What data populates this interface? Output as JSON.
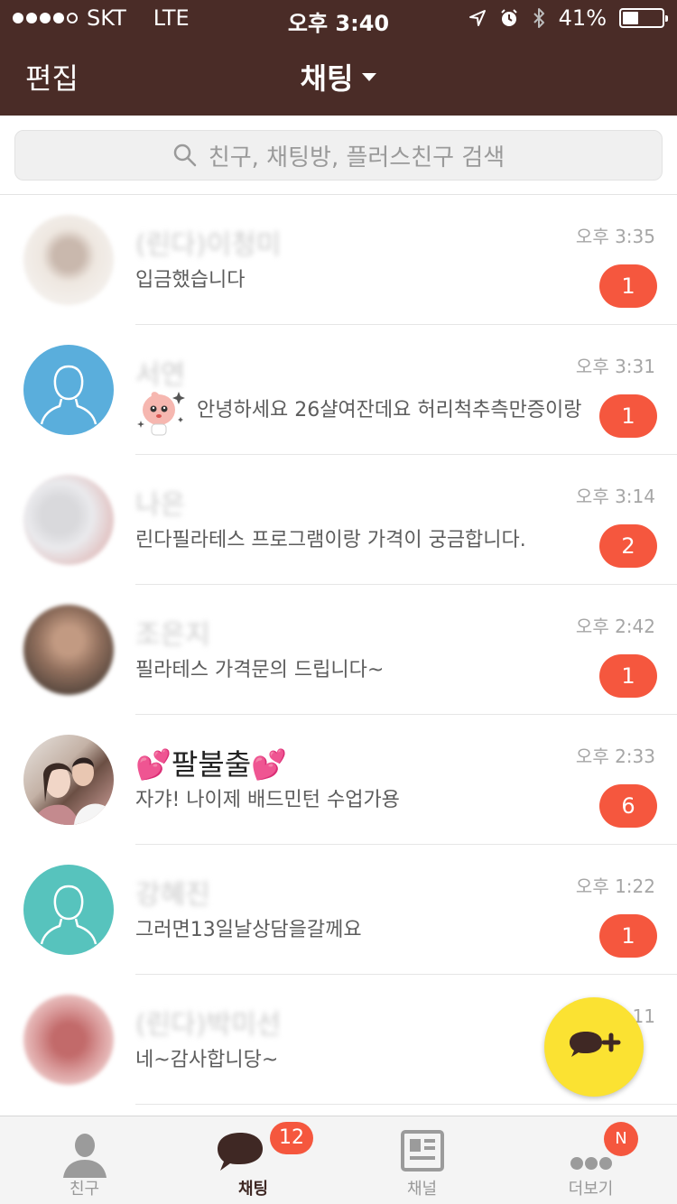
{
  "status_bar": {
    "carrier": "SKT",
    "network": "LTE",
    "time": "오후 3:40",
    "battery_percent": "41%",
    "battery_level": 0.41
  },
  "nav": {
    "edit_label": "편집",
    "title": "채팅"
  },
  "search": {
    "placeholder": "친구, 채팅방, 플러스친구 검색"
  },
  "chats": [
    {
      "name": "(린다)이청미",
      "preview": "입금했습니다",
      "time": "오후 3:35",
      "unread": "1",
      "avatar": "blurred-photo"
    },
    {
      "name": "서연",
      "preview": "안녕하세요 26샬여잔데요 허리척추측만증이랑",
      "time": "오후 3:31",
      "unread": "1",
      "avatar": "default-person",
      "sticker": "apeach-sticker"
    },
    {
      "name": "나은",
      "preview": "린다필라테스 프로그램이랑 가격이 궁금합니다.",
      "time": "오후 3:14",
      "unread": "2",
      "avatar": "blurred-photo"
    },
    {
      "name": "조은지",
      "preview": "필라테스 가격문의 드립니다~",
      "time": "오후 2:42",
      "unread": "1",
      "avatar": "blurred-photo"
    },
    {
      "name": "팔불출",
      "preview": "자갸! 나이제 배드민턴 수업가용",
      "time": "오후 2:33",
      "unread": "6",
      "avatar": "couple-photo"
    },
    {
      "name": "강혜진",
      "preview": "그러면13일날상담을갈께요",
      "time": "오후 1:22",
      "unread": "1",
      "avatar": "default-person"
    },
    {
      "name": "(린다)박미선",
      "preview": "네~감사합니당~",
      "time": "오후 1:11",
      "unread": "",
      "avatar": "blurred-photo"
    }
  ],
  "fab": {
    "icon": "new-chat-icon"
  },
  "tabs": [
    {
      "label": "친구",
      "icon": "person-icon",
      "badge": ""
    },
    {
      "label": "채팅",
      "icon": "chat-bubble-icon",
      "badge": "12"
    },
    {
      "label": "채널",
      "icon": "channel-icon",
      "badge": ""
    },
    {
      "label": "더보기",
      "icon": "more-icon",
      "badge": "N"
    }
  ],
  "colors": {
    "header_bg": "#4a2c27",
    "badge": "#f5573e",
    "fab": "#fbe232"
  }
}
